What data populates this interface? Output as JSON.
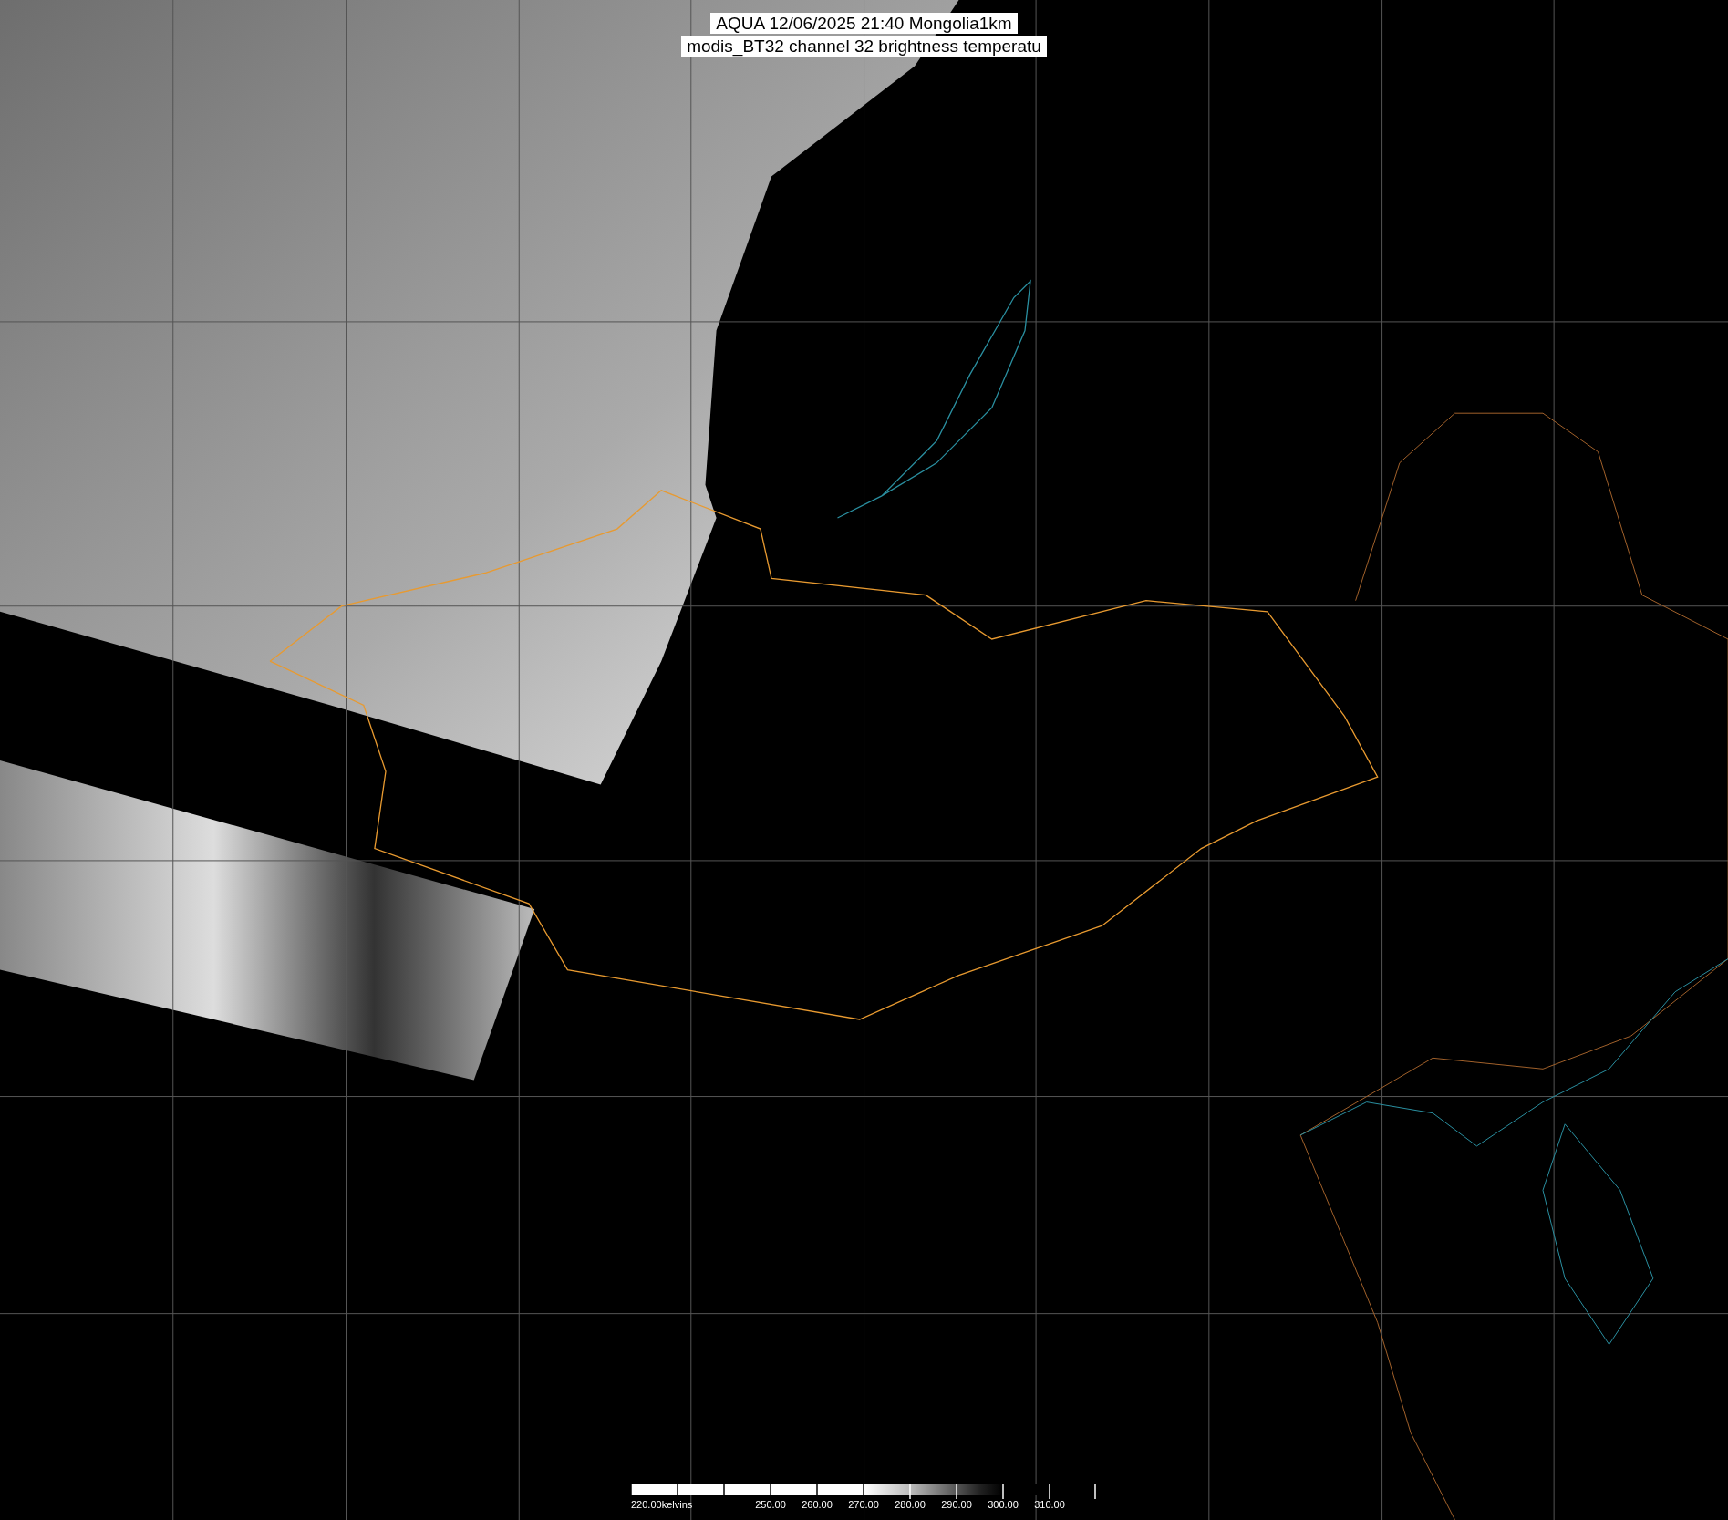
{
  "title": {
    "lines": [
      "AQUA 12/06/2025 21:40 Mongolia1km",
      "modis_BT32 channel 32 brightness temperatu"
    ]
  },
  "colorbar": {
    "labels": [
      "220.00kelvins",
      "250.00",
      "260.00",
      "270.00",
      "280.00",
      "290.00",
      "300.00",
      "310.00"
    ]
  }
}
